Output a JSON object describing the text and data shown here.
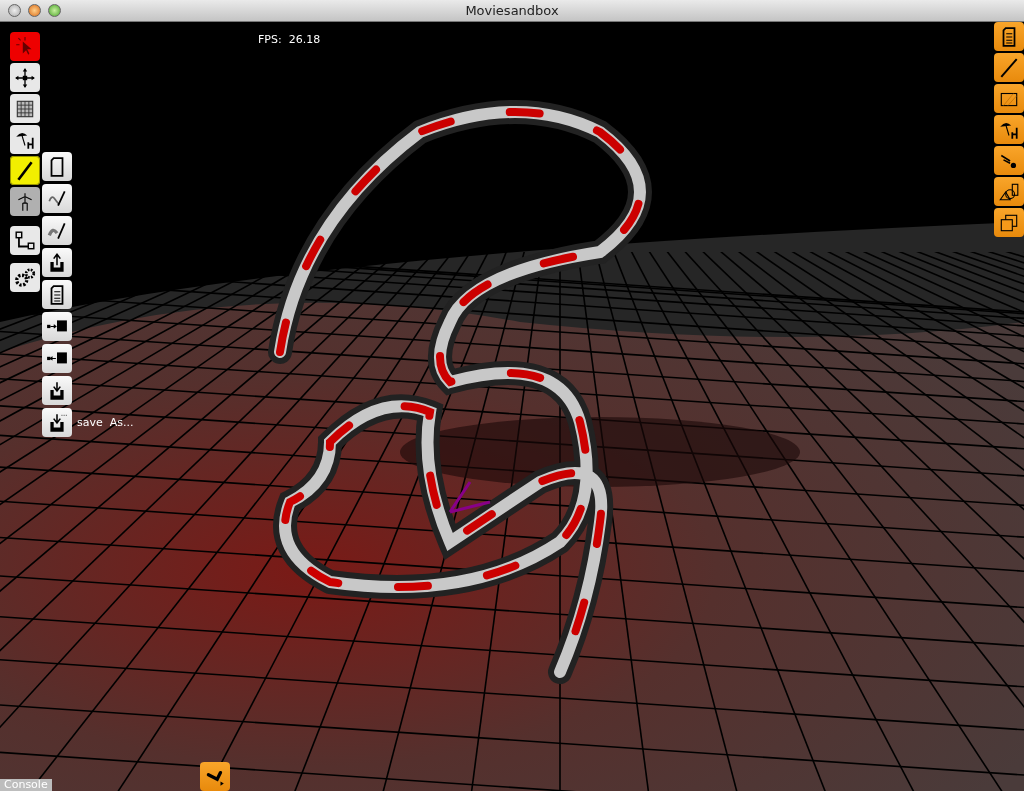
{
  "window": {
    "title": "Moviesandbox"
  },
  "fps": "FPS:  26.18",
  "left_tools": [
    {
      "color": "#ee0000",
      "selected": false
    },
    {
      "color": "#e8e8e8",
      "selected": false
    },
    {
      "color": "#e8e8e8",
      "selected": false
    },
    {
      "color": "#e8e8e8",
      "selected": false
    },
    {
      "color": "#f2ef00",
      "selected": true
    },
    {
      "color": "#b0b0b0",
      "selected": false
    },
    {
      "color": "#e8e8e8",
      "selected": false
    },
    {
      "color": "#e8e8e8",
      "selected": false
    }
  ],
  "submenu_label": "save  As...",
  "console": {
    "label": "Console"
  }
}
